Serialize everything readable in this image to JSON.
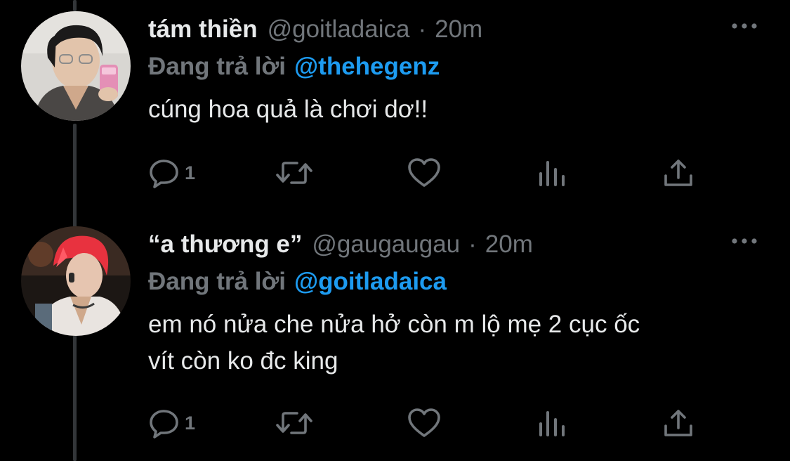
{
  "tweets": [
    {
      "display_name": "tám thiền",
      "handle": "@goitladaica",
      "separator": "·",
      "time": "20m",
      "reply_prefix": "Đang trả lời",
      "reply_to": "@thehegenz",
      "text": "cúng hoa quả là chơi dơ!!",
      "reply_count": "1",
      "icons": {
        "more": "more-horizontal-icon",
        "reply": "reply-icon",
        "retweet": "retweet-icon",
        "like": "heart-icon",
        "analytics": "analytics-icon",
        "share": "share-icon"
      }
    },
    {
      "display_name": "“a thương e”",
      "handle": "@gaugaugau",
      "separator": "·",
      "time": "20m",
      "reply_prefix": "Đang trả lời",
      "reply_to": "@goitladaica",
      "text": "em nó nửa che nửa hở còn m lộ mẹ 2 cục ốc\nvít còn ko đc king",
      "reply_count": "1",
      "icons": {
        "more": "more-horizontal-icon",
        "reply": "reply-icon",
        "retweet": "retweet-icon",
        "like": "heart-icon",
        "analytics": "analytics-icon",
        "share": "share-icon"
      }
    }
  ],
  "colors": {
    "background": "#000000",
    "text_primary": "#e7e9ea",
    "text_secondary": "#71767b",
    "accent": "#1d9bf0",
    "thread_line": "#333639"
  }
}
